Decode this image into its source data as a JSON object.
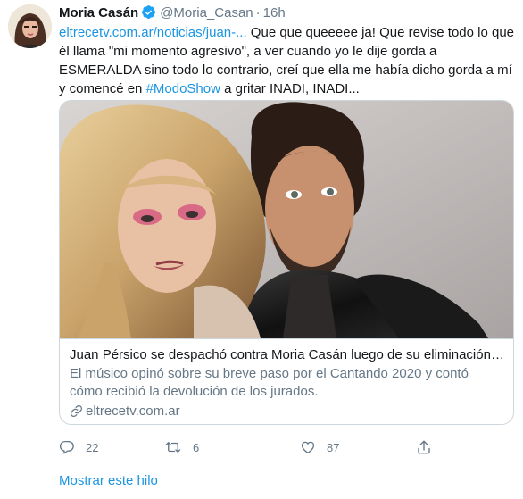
{
  "author": {
    "name": "Moria Casán",
    "handle": "@Moria_Casan",
    "separator": "·",
    "time": "16h"
  },
  "tweet": {
    "link_text": "eltrecetv.com.ar/noticias/juan-...",
    "text_before_hashtag": " Que que queeeee ja! Que revise todo lo que él llama \"mi momento agresivo\", a ver cuando yo le dije gorda a ESMERALDA sino todo lo contrario, creí que ella me había dicho gorda a mí y comencé en ",
    "hashtag": "#ModoShow",
    "text_after_hashtag": " a gritar INADI, INADI..."
  },
  "card": {
    "title": "Juan Pérsico se despachó contra Moria Casán luego de su eliminación d...",
    "description": "El músico opinó sobre su breve paso por el Cantando 2020 y contó cómo recibió la devolución de los jurados.",
    "domain": "eltrecetv.com.ar"
  },
  "actions": {
    "replies": "22",
    "retweets": "6",
    "likes": "87"
  },
  "show_thread": "Mostrar este hilo",
  "colors": {
    "link": "#1b95e0",
    "secondary_text": "#657786",
    "primary_text": "#14171a",
    "border": "#ccd6dd"
  },
  "icons": [
    "verified-badge-icon",
    "reply-icon",
    "retweet-icon",
    "like-icon",
    "share-icon",
    "link-icon"
  ]
}
